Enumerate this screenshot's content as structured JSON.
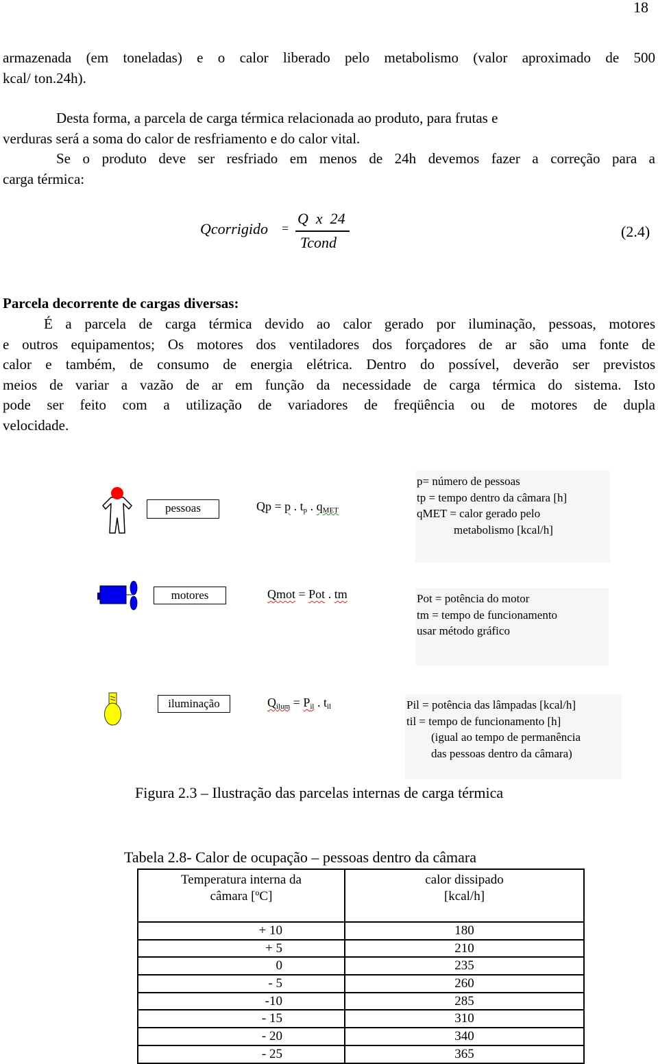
{
  "page_number": "18",
  "paragraphs": {
    "p1_line1": "armazenada (em toneladas) e o calor liberado pelo metabolismo (valor aproximado de 500",
    "p1_line2": "kcal/ ton.24h).",
    "p2_line1": "Desta forma, a parcela de carga térmica relacionada ao produto, para frutas e",
    "p2_line2": "verduras será a soma do calor de resfriamento e do calor vital.",
    "p3_line1": "Se o produto deve ser resfriado em menos de 24h devemos fazer a correção para a",
    "p3_line2": "carga térmica:"
  },
  "equation": {
    "lhs": "Qcorrigido",
    "equals": "=",
    "numerator": "Q  x  24",
    "denominator": "Tcond",
    "number": "(2.4)"
  },
  "section": {
    "heading": "Parcela decorrente de cargas diversas:",
    "lines": [
      "É a parcela de carga térmica devido ao calor gerado por iluminação, pessoas, motores",
      "e outros equipamentos; Os motores dos ventiladores  dos forçadores de ar são uma fonte de",
      "calor e também, de consumo de energia elétrica. Dentro do possível, deverão ser previstos",
      "meios de variar a vazão de ar em função da necessidade de carga térmica do sistema. Isto",
      "pode ser feito com a utilização de variadores de freqüência ou de motores de dupla",
      "velocidade."
    ]
  },
  "figure": {
    "rows": [
      {
        "icon": "person-icon",
        "label": "pessoas",
        "formula": {
          "q": "Qp",
          "eq": " = ",
          "a": "p",
          "dot1": " . ",
          "b": "t",
          "b_sub": "p",
          "dot2": " . ",
          "c": "q",
          "c_sub": "MET"
        },
        "legend": [
          "p= número de pessoas",
          "tp = tempo dentro da câmara [h]",
          "qMET = calor gerado pelo",
          "metabolismo [kcal/h]"
        ]
      },
      {
        "icon": "motor-fan-icon",
        "label": "motores",
        "formula": {
          "q": "Qmot",
          "eq": " = ",
          "a": "Pot",
          "dot1": " . ",
          "b": "tm"
        },
        "legend": [
          "Pot = potência do motor",
          "tm = tempo de funcionamento",
          "usar método gráfico"
        ]
      },
      {
        "icon": "light-bulb-icon",
        "label": "iluminação",
        "formula": {
          "q": "Q",
          "q_sub": "ilum",
          "eq": " = ",
          "a": "P",
          "a_sub": "il",
          "dot1": " . ",
          "b": "t",
          "b_sub": "il"
        },
        "legend": [
          "Pil = potência das lâmpadas [kcal/h]",
          "til = tempo de funcionamento [h]",
          "(igual ao tempo de permanência",
          "das pessoas dentro da câmara)"
        ]
      }
    ],
    "caption": "Figura 2.3 – Ilustração das parcelas internas de carga térmica",
    "colors": {
      "person_head": "#ff0000",
      "motor": "#0000ee",
      "bulb": "#ffff00",
      "legend_bg": "#f7f5f8"
    }
  },
  "table": {
    "title": "Tabela 2.8- Calor de ocupação – pessoas dentro da câmara",
    "headers": [
      {
        "line1": "Temperatura interna da",
        "line2": "câmara [ºC]"
      },
      {
        "line1": "calor dissipado",
        "line2": "[kcal/h]"
      }
    ],
    "rows": [
      [
        "+ 10",
        "180"
      ],
      [
        "+ 5",
        "210"
      ],
      [
        "0",
        "235"
      ],
      [
        "- 5",
        "260"
      ],
      [
        "-10",
        "285"
      ],
      [
        "- 15",
        "310"
      ],
      [
        "- 20",
        "340"
      ],
      [
        "- 25",
        "365"
      ]
    ]
  }
}
